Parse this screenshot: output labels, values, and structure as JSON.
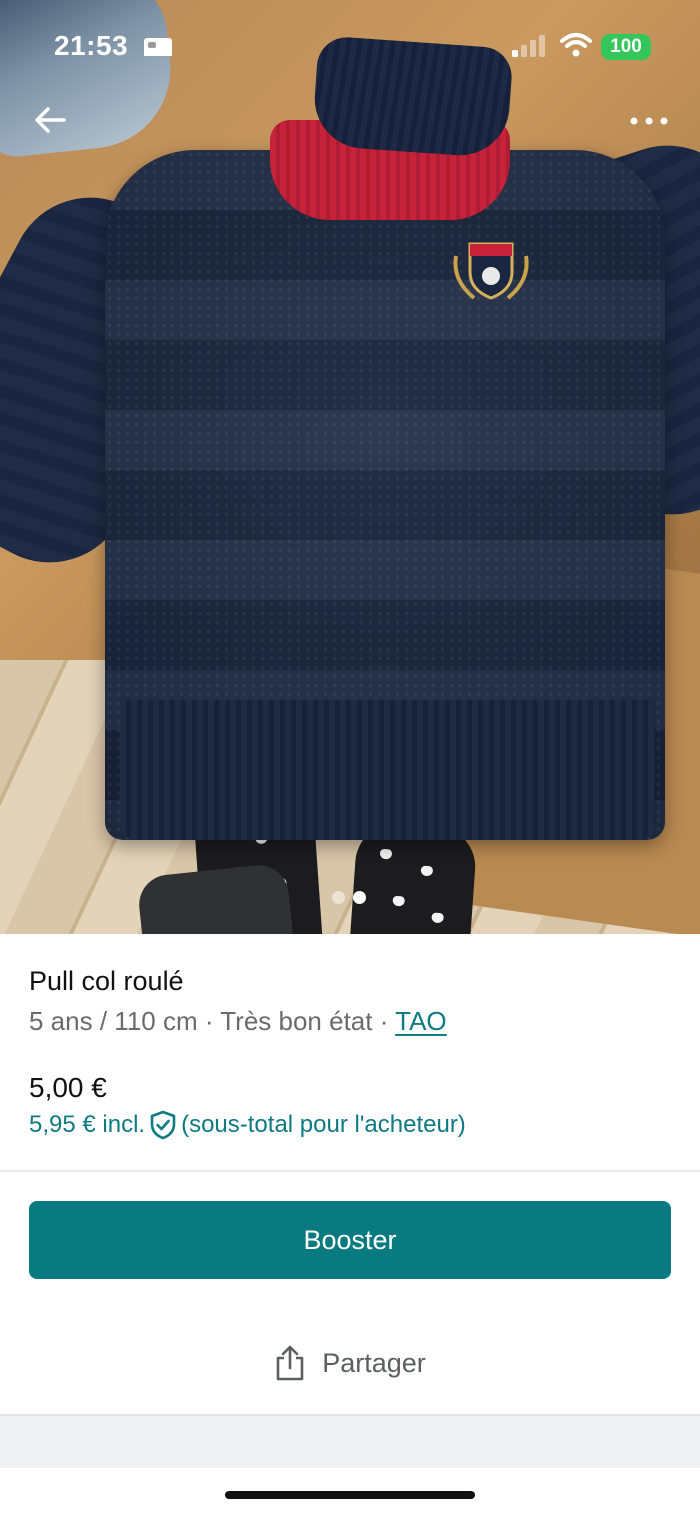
{
  "status_bar": {
    "time": "21:53",
    "battery": "100",
    "battery_color": "#33c759"
  },
  "photo": {
    "pager": {
      "total": 2,
      "active_index": 1
    }
  },
  "item": {
    "title": "Pull col roulé",
    "size": "5 ans / 110 cm",
    "separator": " · ",
    "condition": "Très bon état",
    "brand": "TAO",
    "price": "5,00 €",
    "price_incl": "5,95 € incl.",
    "price_note": "(sous-total pour l'acheteur)"
  },
  "actions": {
    "boost_label": "Booster",
    "share_label": "Partager"
  },
  "icons": {
    "back": "arrow-left-icon",
    "more": "more-horizontal-icon",
    "shield": "shield-check-icon",
    "share": "share-icon"
  },
  "colors": {
    "accent": "#097b80",
    "link": "#0e7a82"
  }
}
